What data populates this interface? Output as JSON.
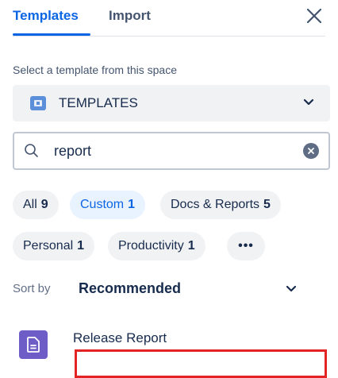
{
  "tabs": [
    {
      "label": "Templates",
      "active": true
    },
    {
      "label": "Import",
      "active": false
    }
  ],
  "space_picker": {
    "label": "Select a template from this space",
    "selected": "TEMPLATES",
    "icon": "space-avatar-icon"
  },
  "search": {
    "value": "report",
    "icon": "search-icon"
  },
  "filters": [
    {
      "label": "All",
      "count": "9",
      "active": false
    },
    {
      "label": "Custom",
      "count": "1",
      "active": true
    },
    {
      "label": "Docs & Reports",
      "count": "5",
      "active": false
    },
    {
      "label": "Personal",
      "count": "1",
      "active": false
    },
    {
      "label": "Productivity",
      "count": "1",
      "active": false
    },
    {
      "label": "•••",
      "active": false
    }
  ],
  "sort": {
    "label": "Sort by",
    "value": "Recommended"
  },
  "results": [
    {
      "title": "Release Report",
      "icon": "document-icon"
    }
  ],
  "colors": {
    "accent": "#0c66e4",
    "chip_bg": "#f1f2f4",
    "chip_active_bg": "#e9f2ff",
    "result_icon_bg": "#6e5dc6",
    "highlight": "#e32424"
  }
}
